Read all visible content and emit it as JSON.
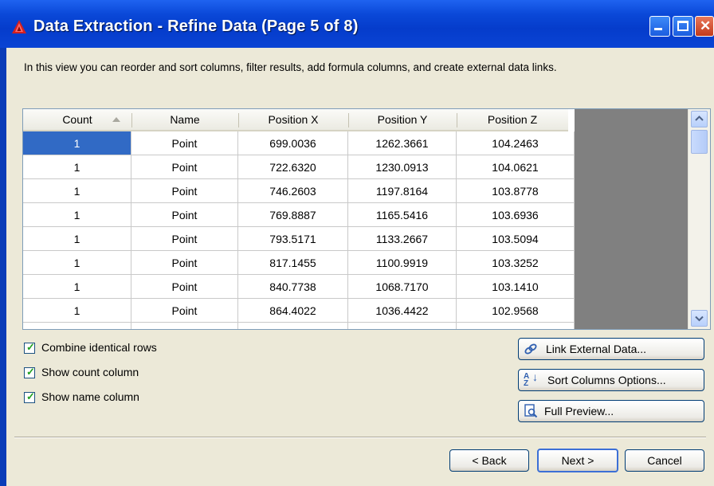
{
  "window": {
    "title": "Data Extraction - Refine Data (Page 5 of 8)",
    "min_glyph": "_",
    "max_glyph": "□",
    "close_glyph": "✕"
  },
  "description": "In this view you can reorder and sort columns, filter results, add formula columns, and create external data links.",
  "table": {
    "columns": [
      "Count",
      "Name",
      "Position X",
      "Position Y",
      "Position Z"
    ],
    "rows": [
      [
        "1",
        "Point",
        "699.0036",
        "1262.3661",
        "104.2463"
      ],
      [
        "1",
        "Point",
        "722.6320",
        "1230.0913",
        "104.0621"
      ],
      [
        "1",
        "Point",
        "746.2603",
        "1197.8164",
        "103.8778"
      ],
      [
        "1",
        "Point",
        "769.8887",
        "1165.5416",
        "103.6936"
      ],
      [
        "1",
        "Point",
        "793.5171",
        "1133.2667",
        "103.5094"
      ],
      [
        "1",
        "Point",
        "817.1455",
        "1100.9919",
        "103.3252"
      ],
      [
        "1",
        "Point",
        "840.7738",
        "1068.7170",
        "103.1410"
      ],
      [
        "1",
        "Point",
        "864.4022",
        "1036.4422",
        "102.9568"
      ]
    ],
    "selected_cell": "row 1, Count",
    "sort_column": "Count"
  },
  "options": {
    "combine_rows": {
      "label": "Combine identical rows",
      "checked": true
    },
    "show_count": {
      "label": "Show count column",
      "checked": true
    },
    "show_name": {
      "label": "Show name column",
      "checked": true
    }
  },
  "actions": {
    "link_external": "Link External Data...",
    "sort_columns": "Sort Columns Options...",
    "full_preview": "Full Preview..."
  },
  "nav": {
    "back": "< Back",
    "next": "Next >",
    "cancel": "Cancel"
  },
  "icons": {
    "app": "autocad-icon",
    "link": "link-icon",
    "sort": "sort-az-icon",
    "preview": "preview-icon"
  },
  "colors": {
    "titlebar": "#0a48d8",
    "selection": "#316ac5",
    "dialog_bg": "#ece9d8"
  }
}
